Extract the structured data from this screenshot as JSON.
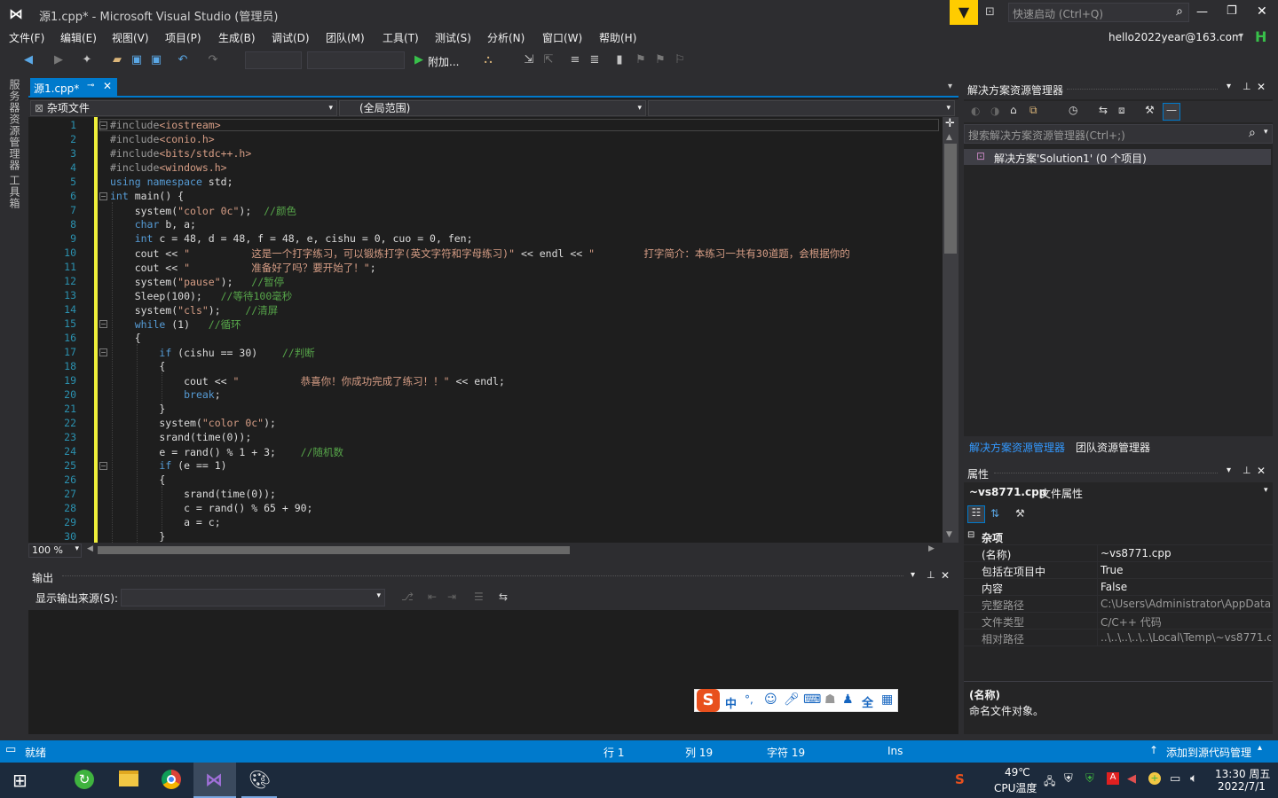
{
  "title": {
    "window_title": "源1.cpp* - Microsoft Visual Studio (管理员)",
    "quick_launch_placeholder": "快速启动 (Ctrl+Q)",
    "minimize": "—",
    "restore": "❐",
    "close": "✕"
  },
  "menu": [
    "文件(F)",
    "编辑(E)",
    "视图(V)",
    "项目(P)",
    "生成(B)",
    "调试(D)",
    "团队(M)",
    "工具(T)",
    "测试(S)",
    "分析(N)",
    "窗口(W)",
    "帮助(H)"
  ],
  "account": {
    "email": "hello2022year@163.com",
    "avatar_letter": "H"
  },
  "toolbar": {
    "attach_label": "附加..."
  },
  "left_tabs": [
    "服务器资源管理器",
    "工具箱"
  ],
  "editor": {
    "tab_label": "源1.cpp*",
    "nav_file": "杂项文件",
    "nav_scope": "(全局范围)",
    "zoom": "100 %",
    "lines": [
      {
        "n": "1",
        "html": "<span class='pp'>#include</span><span class='inc'>&lt;iostream&gt;</span>"
      },
      {
        "n": "2",
        "html": "<span class='pp'>#include</span><span class='inc'>&lt;conio.h&gt;</span>"
      },
      {
        "n": "3",
        "html": "<span class='pp'>#include</span><span class='inc'>&lt;bits/stdc++.h&gt;</span>"
      },
      {
        "n": "4",
        "html": "<span class='pp'>#include</span><span class='inc'>&lt;windows.h&gt;</span>"
      },
      {
        "n": "5",
        "html": "<span class='kw'>using</span> <span class='kw'>namespace</span> std;"
      },
      {
        "n": "6",
        "html": "<span class='kw'>int</span> main() {"
      },
      {
        "n": "7",
        "html": "    system(<span class='str'>\"color 0c\"</span>);  <span class='cm'>//颜色</span>"
      },
      {
        "n": "8",
        "html": "    <span class='kw'>char</span> b, a;"
      },
      {
        "n": "9",
        "html": "    <span class='kw'>int</span> c = 48, d = 48, f = 48, e, cishu = 0, cuo = 0, fen;"
      },
      {
        "n": "10",
        "html": "    cout &lt;&lt; <span class='str'>\"          这是一个打字练习，可以锻炼打字(英文字符和字母练习)\"</span> &lt;&lt; endl &lt;&lt; <span class='str'>\"        打字简介：本练习一共有30道题，会根据你的</span>"
      },
      {
        "n": "11",
        "html": "    cout &lt;&lt; <span class='str'>\"          准备好了吗？要开始了！\"</span>;"
      },
      {
        "n": "12",
        "html": "    system(<span class='str'>\"pause\"</span>);   <span class='cm'>//暂停</span>"
      },
      {
        "n": "13",
        "html": "    Sleep(100);   <span class='cm'>//等待100毫秒</span>"
      },
      {
        "n": "14",
        "html": "    system(<span class='str'>\"cls\"</span>);    <span class='cm'>//清屏</span>"
      },
      {
        "n": "15",
        "html": "    <span class='kw'>while</span> (1)   <span class='cm'>//循环</span>"
      },
      {
        "n": "16",
        "html": "    {"
      },
      {
        "n": "17",
        "html": "        <span class='kw'>if</span> (cishu == 30)    <span class='cm'>//判断</span>"
      },
      {
        "n": "18",
        "html": "        {"
      },
      {
        "n": "19",
        "html": "            cout &lt;&lt; <span class='str'>\"          恭喜你！你成功完成了练习！！\"</span> &lt;&lt; endl;"
      },
      {
        "n": "20",
        "html": "            <span class='kw'>break</span>;"
      },
      {
        "n": "21",
        "html": "        }"
      },
      {
        "n": "22",
        "html": "        system(<span class='str'>\"color 0c\"</span>);"
      },
      {
        "n": "23",
        "html": "        srand(time(0));"
      },
      {
        "n": "24",
        "html": "        e = rand() % 1 + 3;    <span class='cm'>//随机数</span>"
      },
      {
        "n": "25",
        "html": "        <span class='kw'>if</span> (e == 1)"
      },
      {
        "n": "26",
        "html": "        {"
      },
      {
        "n": "27",
        "html": "            srand(time(0));"
      },
      {
        "n": "28",
        "html": "            c = rand() % 65 + 90;"
      },
      {
        "n": "29",
        "html": "            a = c;"
      },
      {
        "n": "30",
        "html": "        }"
      }
    ]
  },
  "output": {
    "title": "输出",
    "source_label": "显示输出来源(S):"
  },
  "solution_explorer": {
    "title": "解决方案资源管理器",
    "search_placeholder": "搜索解决方案资源管理器(Ctrl+;)",
    "solution_item": "解决方案'Solution1' (0 个项目)",
    "bottom_tabs": [
      "解决方案资源管理器",
      "团队资源管理器"
    ]
  },
  "properties": {
    "title": "属性",
    "object": "~vs8771.cpp",
    "object_type": "文件属性",
    "category": "杂项",
    "rows": [
      {
        "k": "(名称)",
        "v": "~vs8771.cpp"
      },
      {
        "k": "包括在项目中",
        "v": "True"
      },
      {
        "k": "内容",
        "v": "False"
      },
      {
        "k": "完整路径",
        "v": "C:\\Users\\Administrator\\AppData\\"
      },
      {
        "k": "文件类型",
        "v": "C/C++ 代码"
      },
      {
        "k": "相对路径",
        "v": "..\\..\\..\\..\\..\\Local\\Temp\\~vs8771.cp"
      }
    ],
    "desc_title": "(名称)",
    "desc_text": "命名文件对象。"
  },
  "ime": {
    "glyph": "S",
    "mode": "中"
  },
  "status": {
    "ready": "就绪",
    "row": "行 1",
    "col": "列 19",
    "char": "字符 19",
    "ins": "Ins",
    "source_control": "添加到源代码管理"
  },
  "taskbar": {
    "temp": "49℃",
    "temp_label": "CPU温度",
    "time": "13:30 周五",
    "date": "2022/7/1"
  },
  "colors": {
    "accent": "#007acc",
    "bg": "#2d2d30",
    "editor_bg": "#1e1e1e"
  }
}
